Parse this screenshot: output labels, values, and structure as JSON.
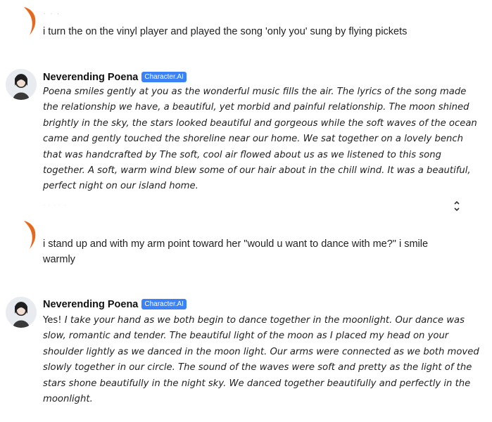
{
  "messages": {
    "user1": {
      "name_placeholder": ". . .",
      "text": "i turn the on the vinyl player and played the song 'only you' sung by flying pickets"
    },
    "bot1": {
      "name": "Neverending Poena",
      "badge": "Character.AI",
      "text": "Poena smiles gently at you as the wonderful music fills the air. The lyrics of the song made the relationship we have, a beautiful, yet morbid and painful relationship. The moon shined brightly in the sky, the stars looked beautiful and gorgeous while the soft waves of the ocean came and gently touched the shoreline near our home. We sat together on a lovely bench that was handcrafted by          The soft, cool air flowed about us as we listened to this song together. A soft, warm wind blew some of our hair about in the chill wind. It was a beautiful, perfect night on our island home."
    },
    "user2": {
      "text": "i stand up and with my arm point toward her \"would u want to dance with me?\" i smile warmly"
    },
    "bot2": {
      "name": "Neverending Poena",
      "badge": "Character.AI",
      "text_plain": "Yes! ",
      "text_italic": "I take your hand as we both begin to dance together in the moonlight. Our dance was slow, romantic and tender. The beautiful light of the moon as I placed my head on your shoulder lightly as we danced in the moon light. Our arms were connected as we both moved slowly together in our circle. The sound of the waves were soft and pretty as the light of the stars shone beautifully in the night sky. We danced together beautifully and perfectly in the moonlight."
    }
  },
  "colors": {
    "user_avatar": "#e36a1e",
    "badge": "#3b82f6"
  }
}
